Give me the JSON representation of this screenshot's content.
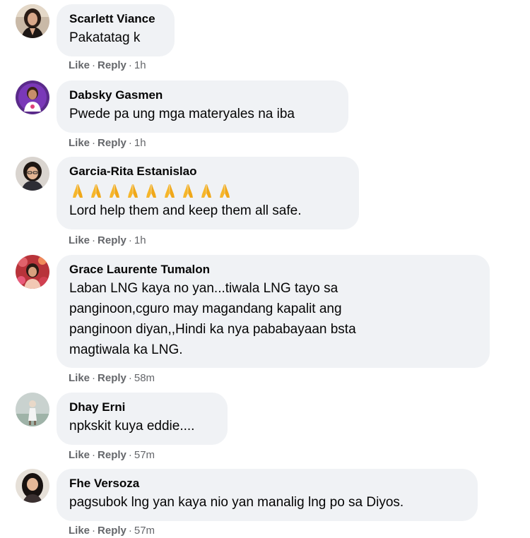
{
  "comments": [
    {
      "name": "Scarlett Viance",
      "text": "Pakatatag k",
      "like_label": "Like",
      "reply_label": "Reply",
      "separator": "·",
      "time": "1h",
      "avatar_icon": "profile-photo-woman-dark-hair"
    },
    {
      "name": "Dabsky Gasmen",
      "text": "Pwede pa ung mga materyales na iba",
      "like_label": "Like",
      "reply_label": "Reply",
      "separator": "·",
      "time": "1h",
      "avatar_icon": "profile-photo-purple"
    },
    {
      "name": "Garcia-Rita Estanislao",
      "emoji": "🙏🙏🙏🙏🙏🙏🙏🙏🙏",
      "emoji_icon": "folded-hands-icon",
      "emoji_count": 9,
      "text": "Lord help them and keep them all safe.",
      "like_label": "Like",
      "reply_label": "Reply",
      "separator": "·",
      "time": "1h",
      "avatar_icon": "profile-photo-woman-glasses"
    },
    {
      "name": "Grace Laurente Tumalon",
      "text_lines": [
        "Laban LNG kaya no yan...tiwala LNG tayo sa",
        "panginoon,cguro may magandang kapalit ang",
        "panginoon diyan,,Hindi ka nya pababayaan bsta",
        "magtiwala ka LNG."
      ],
      "like_label": "Like",
      "reply_label": "Reply",
      "separator": "·",
      "time": "58m",
      "avatar_icon": "profile-photo-flowers"
    },
    {
      "name": "Dhay Erni",
      "text": "npkskit kuya eddie....",
      "like_label": "Like",
      "reply_label": "Reply",
      "separator": "·",
      "time": "57m",
      "avatar_icon": "profile-photo-outdoor"
    },
    {
      "name": "Fhe Versoza",
      "text": "pagsubok lng yan kaya nio yan manalig lng po sa Diyos.",
      "like_label": "Like",
      "reply_label": "Reply",
      "separator": "·",
      "time": "57m",
      "avatar_icon": "profile-photo-woman-long-hair"
    }
  ],
  "colors": {
    "bubble_bg": "#f0f2f5",
    "text": "#050505",
    "meta": "#65676b"
  }
}
